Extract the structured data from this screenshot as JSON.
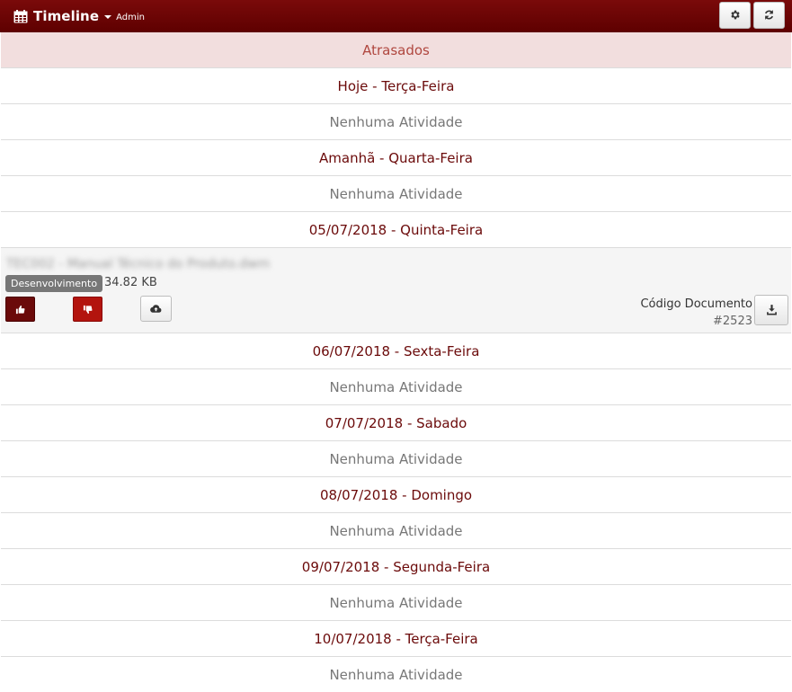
{
  "header": {
    "title": "Timeline",
    "user": "Admin",
    "icon": "calendar-icon",
    "buttons": [
      {
        "name": "settings",
        "icon": "gear-icon"
      },
      {
        "name": "refresh",
        "icon": "refresh-icon"
      }
    ]
  },
  "colors": {
    "header_bg": "#6b0000",
    "date_text": "#6b0a0a",
    "overdue_bg": "#f2dede",
    "overdue_text": "#b0473f",
    "empty_text": "#777777",
    "badge_bg": "#777777"
  },
  "timeline": {
    "overdue_label": "Atrasados",
    "rows": [
      {
        "date": "Hoje - Terça-Feira",
        "empty": "Nenhuma Atividade"
      },
      {
        "date": "Amanhã - Quarta-Feira",
        "empty": "Nenhuma Atividade"
      },
      {
        "date": "05/07/2018 - Quinta-Feira"
      },
      {
        "date": "06/07/2018 - Sexta-Feira",
        "empty": "Nenhuma Atividade"
      },
      {
        "date": "07/07/2018 - Sabado",
        "empty": "Nenhuma Atividade"
      },
      {
        "date": "08/07/2018 - Domingo",
        "empty": "Nenhuma Atividade"
      },
      {
        "date": "09/07/2018 - Segunda-Feira",
        "empty": "Nenhuma Atividade"
      },
      {
        "date": "10/07/2018 - Terça-Feira",
        "empty": "Nenhuma Atividade"
      }
    ]
  },
  "activity": {
    "title_blurred": "TEC002 - Manual Técnico do Produto.dwm",
    "badge": "Desenvolvimento",
    "size": "34.82 KB",
    "doc_label": "Código Documento",
    "doc_code": "#2523",
    "icons": {
      "like": "thumbs-up-icon",
      "dislike": "thumbs-down-icon",
      "upload": "cloud-upload-icon",
      "download": "download-icon"
    }
  }
}
